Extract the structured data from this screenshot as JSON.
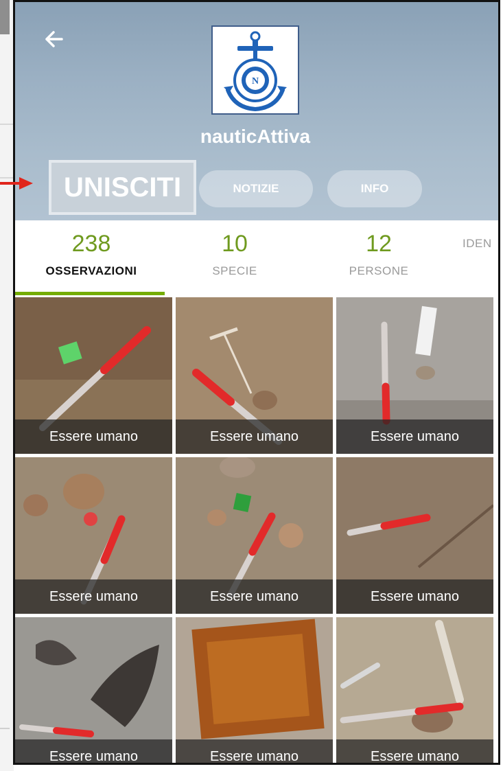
{
  "project": {
    "name": "nauticAttiva"
  },
  "buttons": {
    "join": "UNISCITI",
    "news": "NOTIZIE",
    "info": "INFO"
  },
  "tabs": [
    {
      "count": "238",
      "label": "OSSERVAZIONI",
      "active": true
    },
    {
      "count": "10",
      "label": "SPECIE"
    },
    {
      "count": "12",
      "label": "PERSONE"
    },
    {
      "count": "",
      "label": "IDEN"
    }
  ],
  "observations": [
    {
      "caption": "Essere umano"
    },
    {
      "caption": "Essere umano"
    },
    {
      "caption": "Essere umano"
    },
    {
      "caption": "Essere umano"
    },
    {
      "caption": "Essere umano"
    },
    {
      "caption": "Essere umano"
    },
    {
      "caption": "Essere umano"
    },
    {
      "caption": "Essere umano"
    },
    {
      "caption": "Essere umano"
    }
  ],
  "colors": {
    "accent": "#74ac00",
    "annotation": "#e0251b"
  }
}
